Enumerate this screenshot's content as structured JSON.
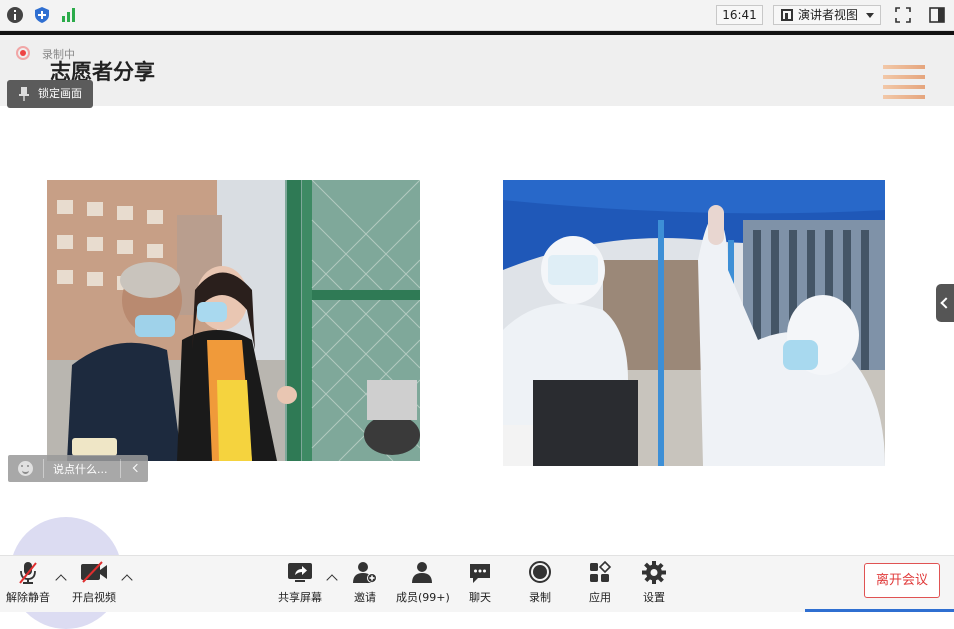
{
  "topbar": {
    "info_icon": "info-icon",
    "shield_icon": "shield-icon",
    "signal_icon": "signal-bars-icon",
    "time": "16:41",
    "view_mode": "演讲者视图",
    "fullscreen_icon": "fullscreen-icon",
    "panel_icon": "side-panel-icon"
  },
  "recording": {
    "label": "录制中"
  },
  "lock_button": {
    "label": "锁定画面"
  },
  "slide": {
    "title": "志愿者分享",
    "accent_color": "#e5a57d"
  },
  "chat_input": {
    "placeholder": "说点什么..."
  },
  "toolbar": {
    "mute": "解除静音",
    "video": "开启视频",
    "share": "共享屏幕",
    "invite": "邀请",
    "members": "成员(99+)",
    "chat": "聊天",
    "record": "录制",
    "apps": "应用",
    "settings": "设置",
    "leave": "离开会议"
  },
  "colors": {
    "leave": "#e03a3a",
    "accent_blue": "#2f6fd1"
  }
}
